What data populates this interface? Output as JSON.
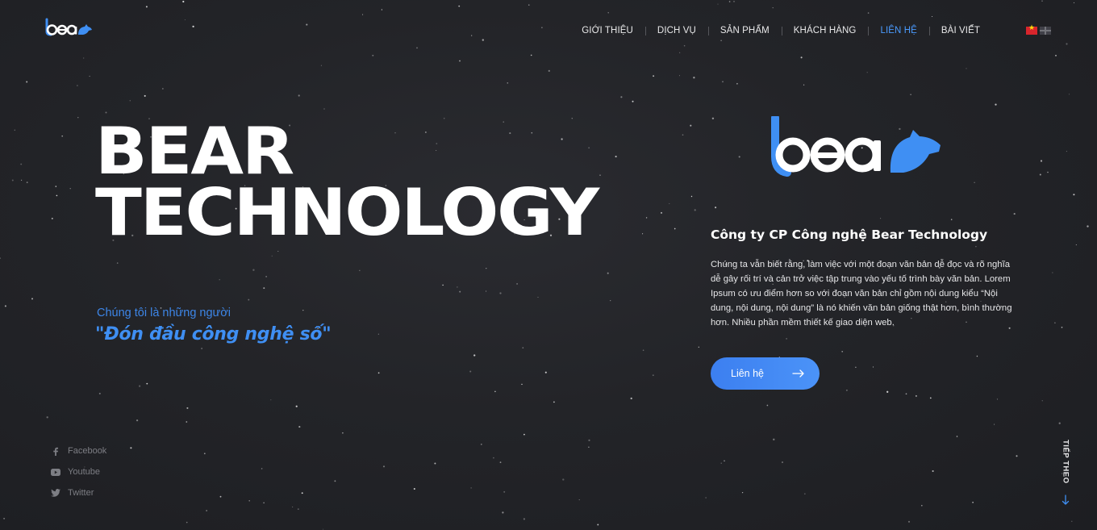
{
  "header": {
    "logo_alt": "bear",
    "nav": [
      {
        "label": "GIỚI THIỆU",
        "active": false
      },
      {
        "label": "DỊCH VỤ",
        "active": false
      },
      {
        "label": "SẢN PHẨM",
        "active": false
      },
      {
        "label": "KHÁCH HÀNG",
        "active": false
      },
      {
        "label": "LIÊN HỆ",
        "active": true
      },
      {
        "label": "BÀI VIẾT",
        "active": false
      }
    ],
    "languages": [
      "vn-flag-icon",
      "uk-flag-icon"
    ]
  },
  "hero": {
    "title_line1": "BEAR",
    "title_line2": "TECHNOLOGY",
    "intro": "Chúng tôi là những người",
    "quote": "\"Đón đầu công nghệ số\""
  },
  "about": {
    "logo_text": "bear",
    "company_name": "Công ty CP Công nghệ Bear Technology",
    "description": "Chúng ta vẫn biết rằng, làm việc với một đoạn văn bản dễ đọc và rõ nghĩa dễ gây rối trí và cản trở việc tập trung vào yếu tố trình bày văn bản. Lorem Ipsum có ưu điểm hơn so với đoạn văn bản chỉ gồm nội dung kiểu “Nội dung, nội dung, nội dung” là nó khiến văn bản giống thật hơn, bình thường hơn. Nhiều phần mềm thiết kế giao diện web.",
    "cta_label": "Liên hệ"
  },
  "socials": [
    {
      "label": "Facebook",
      "icon": "facebook-icon"
    },
    {
      "label": "Youtube",
      "icon": "youtube-icon"
    },
    {
      "label": "Twitter",
      "icon": "twitter-icon"
    }
  ],
  "next": {
    "label": "TIẾP THEO"
  },
  "colors": {
    "accent": "#3f8ff3",
    "background": "#232428",
    "text": "#ffffff"
  }
}
